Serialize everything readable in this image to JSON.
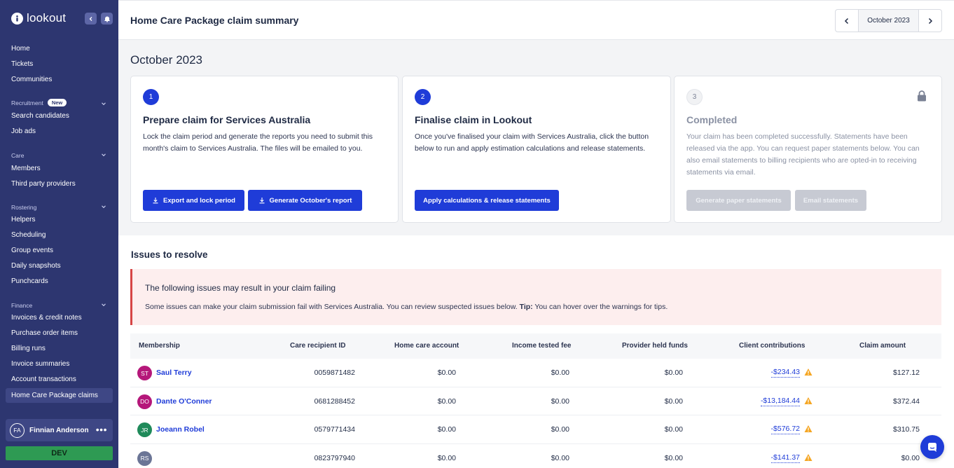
{
  "brand": {
    "name": "lookout"
  },
  "nav": {
    "home": "Home",
    "tickets": "Tickets",
    "communities": "Communities",
    "recruitment_section": "Recruitment",
    "recruitment_badge": "New",
    "search_candidates": "Search candidates",
    "job_ads": "Job ads",
    "care_section": "Care",
    "members": "Members",
    "third_party_providers": "Third party providers",
    "rostering_section": "Rostering",
    "helpers": "Helpers",
    "scheduling": "Scheduling",
    "group_events": "Group events",
    "daily_snapshots": "Daily snapshots",
    "punchcards": "Punchcards",
    "finance_section": "Finance",
    "invoices_credit_notes": "Invoices & credit notes",
    "purchase_order_items": "Purchase order items",
    "billing_runs": "Billing runs",
    "invoice_summaries": "Invoice summaries",
    "account_transactions": "Account transactions",
    "home_care_package_claims": "Home Care Package claims"
  },
  "user": {
    "initials": "FA",
    "name": "Finnian Anderson",
    "more": "•••"
  },
  "env_badge": "DEV",
  "header": {
    "title": "Home Care Package claim summary",
    "period_label": "October 2023"
  },
  "main": {
    "month_heading": "October 2023",
    "cards": [
      {
        "step": "1",
        "title": "Prepare claim for Services Australia",
        "text": "Lock the claim period and generate the reports you need to submit this month's claim to Services Australia. The files will be emailed to you.",
        "btn1": "Export and lock period",
        "btn2": "Generate October's report"
      },
      {
        "step": "2",
        "title": "Finalise claim in Lookout",
        "text": "Once you've finalised your claim with Services Australia, click the button below to run and apply estimation calculations and release statements.",
        "btn1": "Apply calculations & release statements"
      },
      {
        "step": "3",
        "title": "Completed",
        "text": "Your claim has been completed successfully. Statements have been released via the app. You can request paper statements below. You can also email statements to billing recipients who are opted-in to receiving statements via email.",
        "btn1": "Generate paper statements",
        "btn2": "Email statements"
      }
    ],
    "issues": {
      "title": "Issues to resolve",
      "alert_title": "The following issues may result in your claim failing",
      "alert_text": "Some issues can make your claim submission fail with Services Australia. You can review suspected issues below. ",
      "alert_tip_label": "Tip:",
      "alert_tip_text": " You can hover over the warnings for tips."
    },
    "table": {
      "headers": {
        "membership": "Membership",
        "care_recipient_id": "Care recipient ID",
        "home_care_account": "Home care account",
        "income_tested_fee": "Income tested fee",
        "provider_held_funds": "Provider held funds",
        "client_contributions": "Client contributions",
        "claim_amount": "Claim amount"
      },
      "rows": [
        {
          "initials": "ST",
          "avatar_color": "#b5177a",
          "name": "Saul Terry",
          "id": "0059871482",
          "hca": "$0.00",
          "itf": "$0.00",
          "phf": "$0.00",
          "contrib": "-$234.43",
          "claim": "$127.12"
        },
        {
          "initials": "DO",
          "avatar_color": "#b5177a",
          "name": "Dante O'Conner",
          "id": "0681288452",
          "hca": "$0.00",
          "itf": "$0.00",
          "phf": "$0.00",
          "contrib": "-$13,184.44",
          "claim": "$372.44"
        },
        {
          "initials": "JR",
          "avatar_color": "#1f8a5a",
          "name": "Joeann Robel",
          "id": "0579771434",
          "hca": "$0.00",
          "itf": "$0.00",
          "phf": "$0.00",
          "contrib": "-$576.72",
          "claim": "$310.75"
        },
        {
          "initials": "RS",
          "avatar_color": "#6b7596",
          "name": "",
          "id": "0823797940",
          "hca": "$0.00",
          "itf": "$0.00",
          "phf": "$0.00",
          "contrib": "-$141.37",
          "claim": "$0.00"
        }
      ]
    }
  },
  "colors": {
    "sidebar": "#2d3670",
    "accent": "#1f3cd8",
    "alert_bg": "#fdeeee",
    "alert_border": "#d64545",
    "warning": "#f5a623",
    "dev": "#2e9a53"
  }
}
